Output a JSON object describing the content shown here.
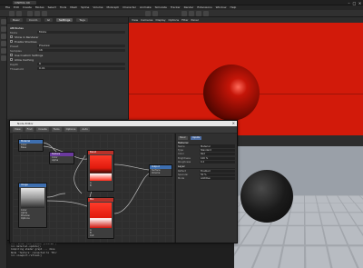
{
  "window": {
    "tab_label": "CINEMA 4D",
    "minimize": "–",
    "maximize": "□",
    "close": "×"
  },
  "menubar": [
    "File",
    "Edit",
    "Create",
    "Modes",
    "Select",
    "Tools",
    "Mesh",
    "Spline",
    "Volume",
    "MoGraph",
    "Character",
    "Animate",
    "Simulate",
    "Tracker",
    "Render",
    "Extensions",
    "Window",
    "Help"
  ],
  "attributes": {
    "tabs": [
      "Basic",
      "Coord.",
      "GI",
      "Settings",
      "Tags"
    ],
    "active_tab": "Settings",
    "header": "Attributes",
    "rows": [
      {
        "label": "Mode",
        "value": "Mode"
      },
      {
        "label": "Preset",
        "value": "Preview"
      },
      {
        "label": "Samples",
        "value": "16"
      },
      {
        "label": "Depth",
        "value": "8"
      },
      {
        "label": "Threshold",
        "value": "0.01"
      }
    ],
    "checks": [
      "Show in Renderer",
      "Enable Shadows",
      "Use Custom Settings",
      "Allow Caching"
    ]
  },
  "viewport_top": {
    "menu": [
      "View",
      "Cameras",
      "Display",
      "Options",
      "Filter",
      "Panel"
    ],
    "color": "#d21a0a"
  },
  "viewport_bottom": {
    "floor_color": "#b8bcc2"
  },
  "node_editor": {
    "title": "Node Editor",
    "toolbar": [
      "View",
      "Find",
      "Create",
      "Tools",
      "Options",
      "Auto"
    ],
    "nodes": [
      {
        "name": "Material",
        "rows": [
          "Color",
          "Base"
        ]
      },
      {
        "name": "Texture",
        "rows": [
          "Color",
          "Alpha"
        ]
      },
      {
        "name": "Blend",
        "rows": [
          "A",
          "B"
        ]
      },
      {
        "name": "Image",
        "rows": [
          "Color",
          "Alpha",
          "Preview",
          "Options"
        ]
      },
      {
        "name": "Output",
        "rows": [
          "Surface",
          "Volume"
        ]
      },
      {
        "name": "Mix",
        "rows": [
          "A",
          "B",
          "Out"
        ]
      }
    ],
    "props": {
      "buttons": [
        "Basic",
        "Inputs"
      ],
      "sections": [
        "Material",
        "Layer"
      ],
      "rows": [
        {
          "k": "Name",
          "v": "Material"
        },
        {
          "k": "Type",
          "v": "Standard"
        },
        {
          "k": "Color",
          "v": "Red"
        },
        {
          "k": "Brightness",
          "v": "100 %"
        },
        {
          "k": "Roughness",
          "v": "0.2"
        },
        {
          "k": "Reflect",
          "v": "Enabled"
        },
        {
          "k": "Specular",
          "v": "50 %"
        },
        {
          "k": "Mode",
          "v": "Additive"
        }
      ]
    }
  },
  "console": {
    "lines": [
      ">>> render.start(mode='preview')",
      ">>> material.update()",
      "Compiling shader graph ... done",
      "Node 'Texture' connected to 'Mix'",
      ">>> viewport.refresh()"
    ]
  }
}
